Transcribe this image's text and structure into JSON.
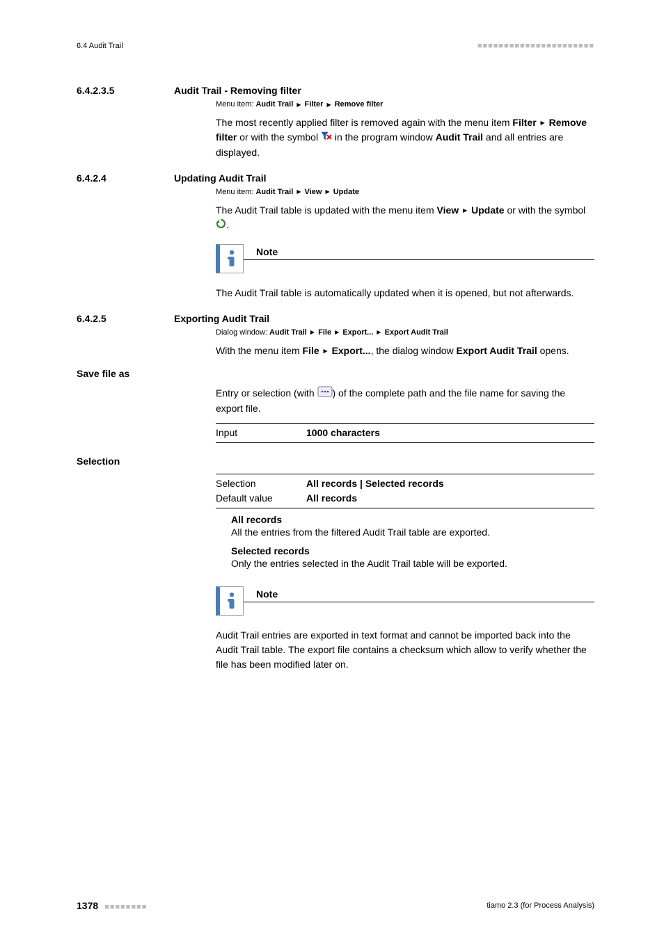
{
  "header": {
    "left": "6.4 Audit Trail",
    "dots": "■■■■■■■■■■■■■■■■■■■■■■"
  },
  "s64235": {
    "num": "6.4.2.3.5",
    "title": "Audit Trail - Removing filter",
    "menu_prefix": "Menu item: ",
    "menu1": "Audit Trail",
    "menu2": "Filter",
    "menu3": "Remove filter",
    "para1a": "The most recently applied filter is removed again with the menu item ",
    "para1b": "Fil­ter",
    "para1c": "Remove filter",
    "para1d": " or with the symbol ",
    "para1e": " in the program window ",
    "para1f": "Audit Trail",
    "para1g": " and all entries are displayed."
  },
  "s6424": {
    "num": "6.4.2.4",
    "title": "Updating Audit Trail",
    "menu_prefix": "Menu item: ",
    "menu1": "Audit Trail",
    "menu2": "View",
    "menu3": "Update",
    "para1a": "The Audit Trail table is updated with the menu item ",
    "para1b": "View",
    "para1c": "Update",
    "para1d": " or with the symbol ",
    "para1e": ".",
    "note_title": "Note",
    "note_body": "The Audit Trail table is automatically updated when it is opened, but not afterwards."
  },
  "s6425": {
    "num": "6.4.2.5",
    "title": "Exporting Audit Trail",
    "dw_prefix": "Dialog window: ",
    "dw1": "Audit Trail",
    "dw2": "File",
    "dw3": "Export...",
    "dw4": "Export Audit Trail",
    "para1a": "With the menu item ",
    "para1b": "File",
    "para1c": "Export...",
    "para1d": ", the dialog window ",
    "para1e": "Export Audit Trail",
    "para1f": " opens.",
    "save_label": "Save file as",
    "save_para_a": "Entry or selection (with ",
    "save_para_b": ") of the complete path and the file name for saving the export file.",
    "input_key": "Input",
    "input_val": "1000 characters",
    "selection_label": "Selection",
    "sel_key": "Selection",
    "sel_val_a": "All records",
    "sel_val_sep": " | ",
    "sel_val_b": "Selected records",
    "def_key": "Default value",
    "def_val": "All records",
    "all_title": "All records",
    "all_body": "All the entries from the filtered Audit Trail table are exported.",
    "selrec_title": "Selected records",
    "selrec_body": "Only the entries selected in the Audit Trail table will be exported.",
    "note_title": "Note",
    "note_body": "Audit Trail entries are exported in text format and cannot be imported back into the Audit Trail table. The export file contains a checksum which allow to verify whether the file has been modified later on."
  },
  "footer": {
    "page": "1378",
    "dots": "■■■■■■■■",
    "right": "tiamo 2.3 (for Process Analysis)"
  }
}
